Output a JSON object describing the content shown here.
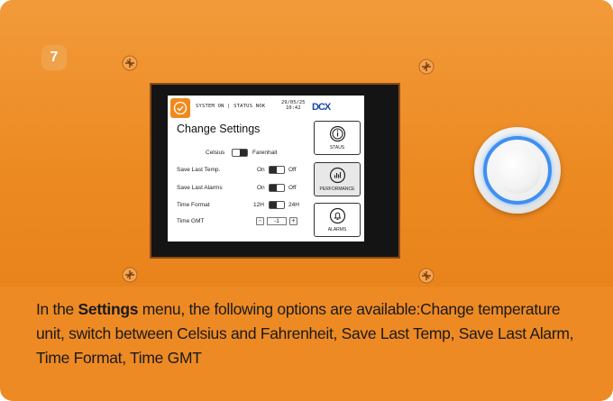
{
  "step_number": "7",
  "colors": {
    "panel_orange": "#ee8a24",
    "check_orange": "#f08a1e",
    "logo_blue": "#1a4aa8",
    "ring_blue": "#3f8ff0"
  },
  "lcd": {
    "status_line": "SYSTEM ON | STATUS NOK",
    "date": "29/05/25",
    "time": "10:42",
    "logo": "DCX",
    "title": "Change Settings",
    "unit_left": "Celsius",
    "unit_right": "Farenhait",
    "rows": [
      {
        "label": "Save Last Temp.",
        "left": "On",
        "right": "Off"
      },
      {
        "label": "Save Last Alarms",
        "left": "On",
        "right": "Off"
      },
      {
        "label": "Time Format",
        "left": "12H",
        "right": "24H"
      }
    ],
    "gmt_label": "Time GMT",
    "gmt_minus": "-",
    "gmt_value": "-1",
    "gmt_plus": "+",
    "side_buttons": [
      {
        "label": "STAUS",
        "icon": "info-icon"
      },
      {
        "label": "PERFORMANCE",
        "icon": "bar-chart-icon"
      },
      {
        "label": "ALARMS",
        "icon": "bell-icon"
      }
    ]
  },
  "caption": {
    "intro": "In the ",
    "bold": "Settings",
    "rest": " menu, the following options are available:Change temperature unit, switch between Celsius and Fahrenheit, Save Last Temp, Save Last Alarm, Time Format, Time GMT"
  }
}
